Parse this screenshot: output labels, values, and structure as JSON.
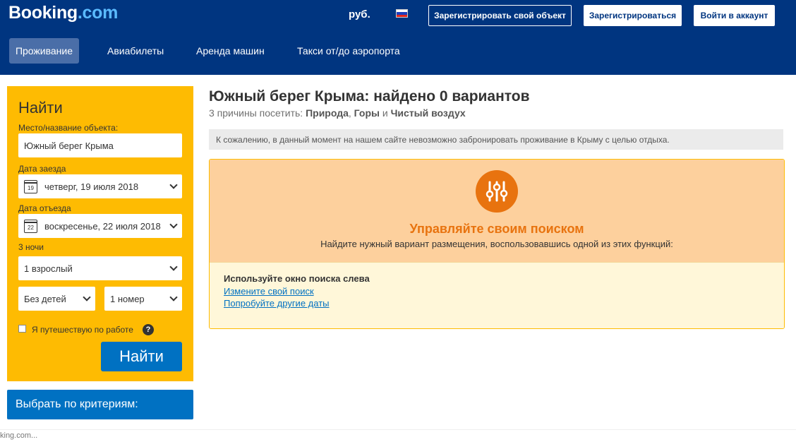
{
  "header": {
    "logo_main": "Booking",
    "logo_suffix": ".com",
    "currency": "руб.",
    "flag_colors": [
      "#ffffff",
      "#1c3fbf",
      "#e1261c"
    ],
    "register_property": "Зарегистрировать свой объект",
    "register": "Зарегистрироваться",
    "login": "Войти в аккаунт"
  },
  "nav": {
    "items": [
      "Проживание",
      "Авиабилеты",
      "Аренда машин",
      "Такси от/до аэропорта"
    ],
    "active_index": 0
  },
  "search": {
    "title": "Найти",
    "destination_label": "Место/название объекта:",
    "destination_value": "Южный берег Крыма",
    "checkin_label": "Дата заезда",
    "checkin_day": "19",
    "checkin_value": "четверг, 19 июля 2018",
    "checkout_label": "Дата отъезда",
    "checkout_day": "22",
    "checkout_value": "воскресенье, 22 июля 2018",
    "nights": "3 ночи",
    "adults": "1 взрослый",
    "children": "Без детей",
    "rooms": "1 номер",
    "business_trip": "Я путешествую по работе",
    "help_symbol": "?",
    "submit": "Найти",
    "criteria": "Выбрать по критериям:"
  },
  "main": {
    "title": "Южный берег Крыма: найдено 0 вариантов",
    "reasons_prefix": "3 причины посетить: ",
    "reason_1": "Природа",
    "sep_1": ", ",
    "reason_2": "Горы",
    "sep_2": " и ",
    "reason_3": "Чистый воздух",
    "notice": "К сожалению, в данный момент на нашем сайте невозможно забронировать проживание в Крыму с целью отдыха.",
    "box_title": "Управляйте своим поиском",
    "box_subtitle": "Найдите нужный вариант размещения, воспользовавшись одной из этих функций:",
    "tip_title": "Используйте окно поиска слева",
    "link_1": "Измените свой поиск",
    "link_2": "Попробуйте другие даты"
  },
  "status_bar": "king.com...",
  "colors": {
    "header_bg": "#003580",
    "search_bg": "#febb02",
    "button_blue": "#0071c2",
    "accent_orange": "#e8730f"
  }
}
